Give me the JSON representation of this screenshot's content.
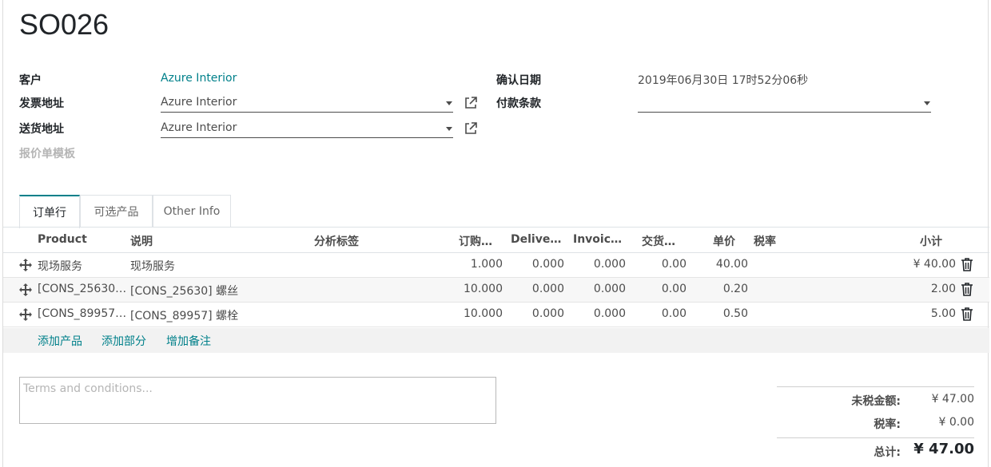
{
  "order": {
    "title": "SO026"
  },
  "fields": {
    "customer_label": "客户",
    "customer_value": "Azure Interior",
    "invoice_address_label": "发票地址",
    "invoice_address_value": "Azure Interior",
    "delivery_address_label": "送货地址",
    "delivery_address_value": "Azure Interior",
    "quote_template_label": "报价单模板",
    "confirm_date_label": "确认日期",
    "confirm_date_value": "2019年06月30日 17时52分06秒",
    "payment_terms_label": "付款条款",
    "payment_terms_value": ""
  },
  "tabs": [
    {
      "label": "订单行",
      "active": true
    },
    {
      "label": "可选产品",
      "active": false
    },
    {
      "label": "Other Info",
      "active": false
    }
  ],
  "table": {
    "headers": {
      "product": "Product",
      "description": "说明",
      "analytic_tags": "分析标签",
      "ordered": "订购…",
      "delivered": "Delive…",
      "invoiced": "Invoic…",
      "lead_time": "交货…",
      "unit_price": "单价",
      "taxes": "税率",
      "subtotal": "小计"
    },
    "rows": [
      {
        "product": "现场服务",
        "description": "现场服务",
        "ordered": "1.000",
        "delivered": "0.000",
        "invoiced": "0.000",
        "lead_time": "0.00",
        "unit_price": "40.00",
        "taxes": "",
        "subtotal": "¥ 40.00"
      },
      {
        "product": "[CONS_25630…",
        "description": "[CONS_25630] 螺丝",
        "ordered": "10.000",
        "delivered": "0.000",
        "invoiced": "0.000",
        "lead_time": "0.00",
        "unit_price": "0.20",
        "taxes": "",
        "subtotal": "2.00"
      },
      {
        "product": "[CONS_89957…",
        "description": "[CONS_89957] 螺栓",
        "ordered": "10.000",
        "delivered": "0.000",
        "invoiced": "0.000",
        "lead_time": "0.00",
        "unit_price": "0.50",
        "taxes": "",
        "subtotal": "5.00"
      }
    ],
    "add_product": "添加产品",
    "add_section": "添加部分",
    "add_note": "增加备注"
  },
  "terms": {
    "placeholder": "Terms and conditions..."
  },
  "totals": {
    "untaxed_label": "未税金额:",
    "untaxed_value": "¥ 47.00",
    "tax_label": "税率:",
    "tax_value": "¥ 0.00",
    "total_label": "总计:",
    "total_value": "¥ 47.00"
  },
  "colors": {
    "accent": "#00808a",
    "text": "#4c4c4c",
    "muted": "#b5b5b5"
  },
  "icons": {
    "external_link": "external-link-icon",
    "drag_handle": "drag-handle-icon",
    "delete": "trash-icon",
    "dropdown": "caret-down-icon"
  }
}
